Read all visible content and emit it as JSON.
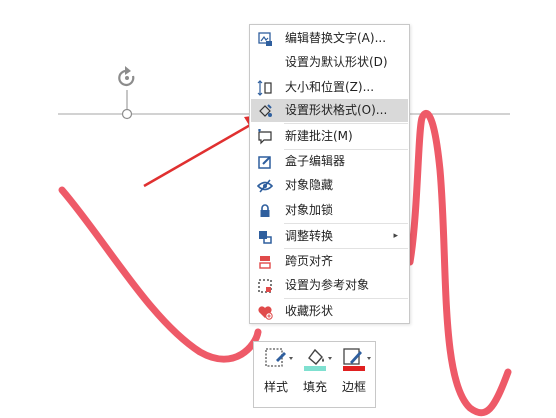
{
  "context_menu": {
    "items": [
      {
        "label": "编辑替换文字(A)...",
        "icon": "alt-text-icon",
        "highlighted": false,
        "has_submenu": false
      },
      {
        "label": "设置为默认形状(D)",
        "icon": "",
        "highlighted": false,
        "has_submenu": false
      },
      {
        "label": "大小和位置(Z)...",
        "icon": "size-position-icon",
        "highlighted": false,
        "has_submenu": false
      },
      {
        "label": "设置形状格式(O)...",
        "icon": "format-shape-icon",
        "highlighted": true,
        "has_submenu": false
      },
      {
        "label": "新建批注(M)",
        "icon": "new-comment-icon",
        "highlighted": false,
        "has_submenu": false
      },
      {
        "label": "盒子编辑器",
        "icon": "box-editor-icon",
        "highlighted": false,
        "has_submenu": false
      },
      {
        "label": "对象隐藏",
        "icon": "hide-object-icon",
        "highlighted": false,
        "has_submenu": false
      },
      {
        "label": "对象加锁",
        "icon": "lock-icon",
        "highlighted": false,
        "has_submenu": false
      },
      {
        "label": "调整转换",
        "icon": "adjust-convert-icon",
        "highlighted": false,
        "has_submenu": true
      },
      {
        "label": "跨页对齐",
        "icon": "cross-page-align-icon",
        "highlighted": false,
        "has_submenu": false
      },
      {
        "label": "设置为参考对象",
        "icon": "reference-object-icon",
        "highlighted": false,
        "has_submenu": false
      },
      {
        "label": "收藏形状",
        "icon": "favorite-shape-icon",
        "highlighted": false,
        "has_submenu": false
      }
    ],
    "submenu_arrow": "▸"
  },
  "mini_toolbar": {
    "buttons": [
      {
        "label": "样式",
        "icon": "style-icon"
      },
      {
        "label": "填充",
        "icon": "fill-bucket-icon"
      },
      {
        "label": "边框",
        "icon": "border-pen-icon"
      }
    ]
  },
  "colors": {
    "curve": "#ee5a68",
    "arrow": "#e03030",
    "guide_line": "#a6a6a6",
    "menu_highlight": "#d9d9d9",
    "icon_blue": "#2f5f9e",
    "icon_red": "#e04a4a",
    "fill_swatch": "#7fe0d0",
    "border_swatch": "#e02020"
  }
}
